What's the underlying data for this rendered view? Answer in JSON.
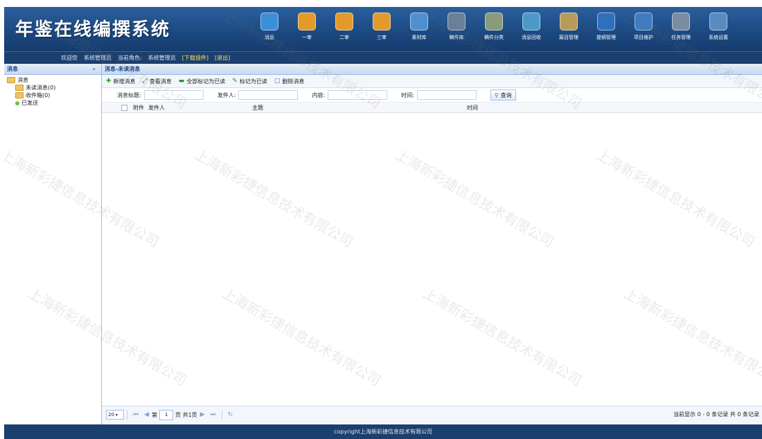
{
  "app": {
    "title": "年鉴在线编撰系统"
  },
  "topnav": [
    {
      "label": "消息",
      "icon": "message-icon",
      "color": "#3b8fd8"
    },
    {
      "label": "一审",
      "icon": "edit-icon",
      "color": "#e39a2b"
    },
    {
      "label": "二审",
      "icon": "edit-icon",
      "color": "#e39a2b"
    },
    {
      "label": "三审",
      "icon": "edit-icon",
      "color": "#e39a2b"
    },
    {
      "label": "素材库",
      "icon": "folder-icon",
      "color": "#4f8fd0"
    },
    {
      "label": "稿件库",
      "icon": "document-icon",
      "color": "#6a7f98"
    },
    {
      "label": "稿件分类",
      "icon": "category-icon",
      "color": "#8a9a7a"
    },
    {
      "label": "消息回收",
      "icon": "recycle-icon",
      "color": "#4a9ac9"
    },
    {
      "label": "篇目管理",
      "icon": "outline-icon",
      "color": "#b89a5a"
    },
    {
      "label": "提纲管理",
      "icon": "list-icon",
      "color": "#2f6fbd"
    },
    {
      "label": "项目维护",
      "icon": "database-icon",
      "color": "#3d7cc4"
    },
    {
      "label": "任务管理",
      "icon": "task-icon",
      "color": "#7a8ca3"
    },
    {
      "label": "系统设置",
      "icon": "settings-icon",
      "color": "#5a8ac0"
    }
  ],
  "subnav": [
    {
      "label": "欢迎您",
      "hl": false
    },
    {
      "label": "系统管理员",
      "hl": false
    },
    {
      "label": "当前角色:",
      "hl": false
    },
    {
      "label": "系统管理员",
      "hl": false
    },
    {
      "label": "[下载插件]",
      "hl": true
    },
    {
      "label": "[退出]",
      "hl": true
    }
  ],
  "sidebar": {
    "title": "消息",
    "collapse": "«",
    "tree": [
      {
        "label": "消息",
        "level": 0,
        "type": "folder"
      },
      {
        "label": "未读消息(0)",
        "level": 1,
        "type": "folder"
      },
      {
        "label": "收件箱(0)",
        "level": 1,
        "type": "folder"
      },
      {
        "label": "已发送",
        "level": 1,
        "type": "leaf"
      }
    ]
  },
  "main": {
    "breadcrumb": "消息-未读消息",
    "toolbar": [
      {
        "label": "新增消息",
        "icon": "plus-icon",
        "glyph": "✚",
        "color": "#2e9d2e"
      },
      {
        "label": "查看消息",
        "icon": "view-icon",
        "glyph": "⤢",
        "color": "#555"
      },
      {
        "label": "全部标记为已读",
        "icon": "mark-all-icon",
        "glyph": "▬",
        "color": "#2f8f2f"
      },
      {
        "label": "标记为已读",
        "icon": "pencil-icon",
        "glyph": "✎",
        "color": "#2f8f2f"
      },
      {
        "label": "删除消息",
        "icon": "delete-icon",
        "glyph": "▢",
        "color": "#3a6fb5"
      }
    ],
    "search": {
      "title_label": "消息标题:",
      "sender_label": "发件人:",
      "content_label": "内容:",
      "time_label": "时间:",
      "button": "查询"
    },
    "grid": {
      "columns": [
        "附件",
        "发件人",
        "主题",
        "时间"
      ]
    },
    "pager": {
      "page_size": "20",
      "page_prefix": "第",
      "page_value": "1",
      "page_suffix": "页 共1页",
      "info": "当前显示 0 - 0 条记录 共 0 条记录"
    }
  },
  "footer": "copyright上海新彩捷信息技术有限公司",
  "watermark": "上海新彩捷信息技术有限公司"
}
